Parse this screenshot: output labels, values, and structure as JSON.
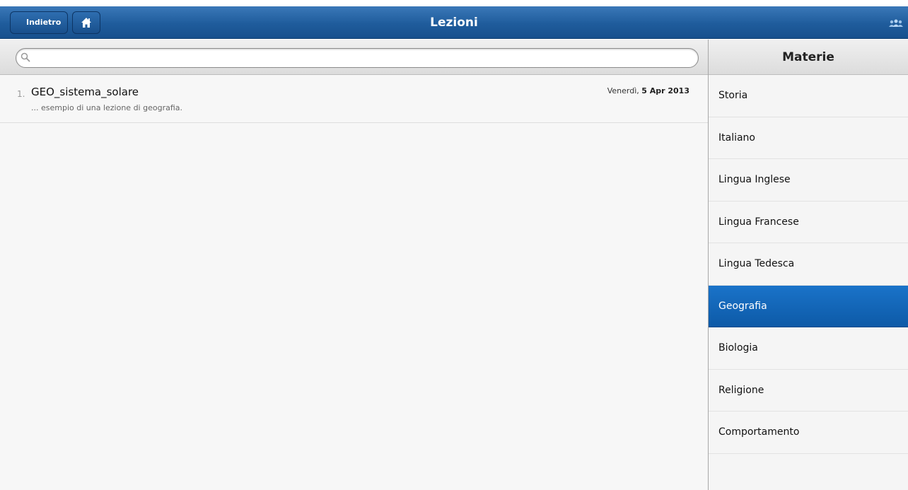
{
  "header": {
    "back_label": "Indietro",
    "title": "Lezioni"
  },
  "search": {
    "placeholder": "",
    "value": ""
  },
  "lessons": [
    {
      "number": "1.",
      "title": "GEO_sistema_solare",
      "description": "... esempio di una lezione di geografia.",
      "date_day": "Venerdì,",
      "date_value": "5 Apr 2013"
    }
  ],
  "subjects": {
    "title": "Materie",
    "items": [
      {
        "label": "Storia"
      },
      {
        "label": "Italiano"
      },
      {
        "label": "Lingua Inglese"
      },
      {
        "label": "Lingua Francese"
      },
      {
        "label": "Lingua Tedesca"
      },
      {
        "label": "Geografia",
        "selected": true
      },
      {
        "label": "Biologia"
      },
      {
        "label": "Religione"
      },
      {
        "label": "Comportamento"
      }
    ]
  },
  "icons": {
    "home": "home-icon",
    "search": "search-icon",
    "users": "users-icon"
  },
  "colors": {
    "header_blue": "#1f5c9c",
    "selected_blue": "#1a73c9"
  }
}
